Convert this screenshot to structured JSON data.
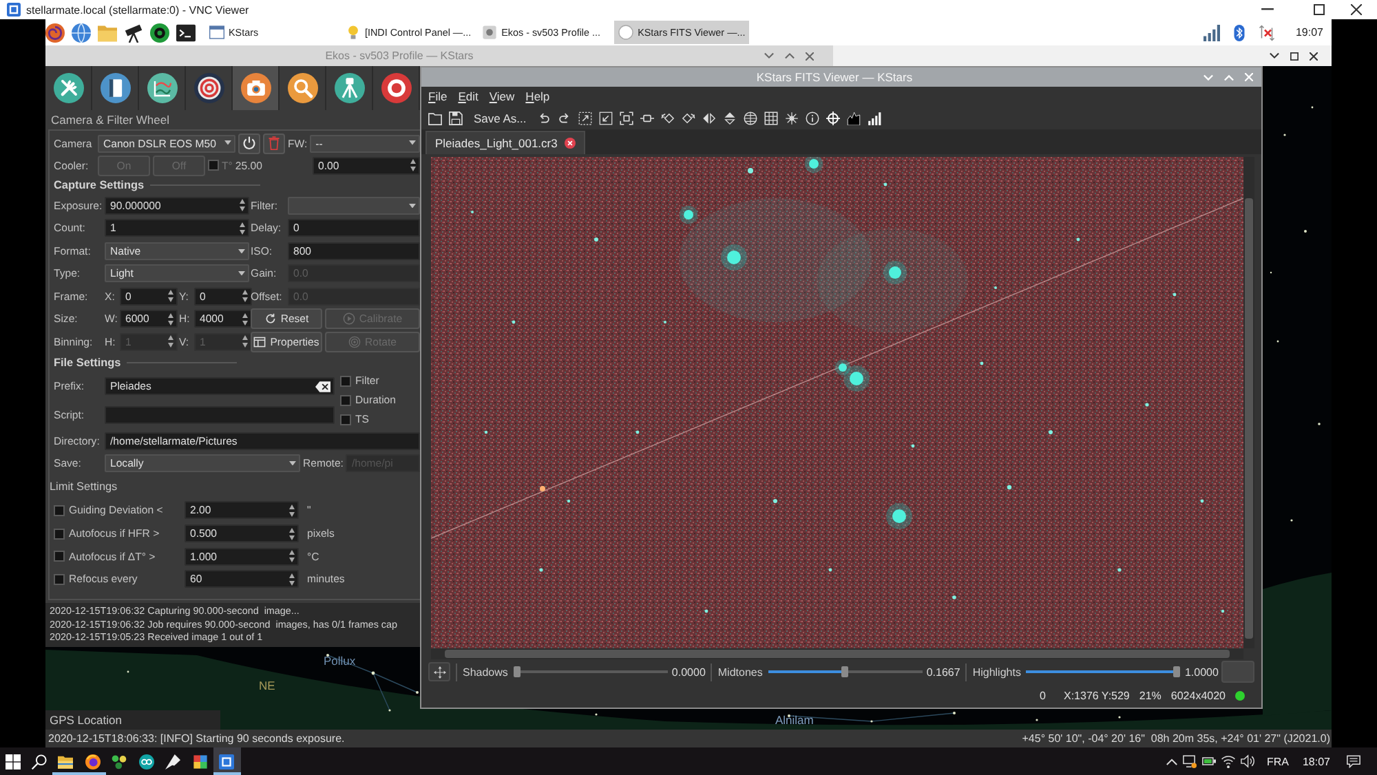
{
  "vnc_window": {
    "title": "stellarmate.local (stellarmate:0) - VNC Viewer"
  },
  "pi_taskbar": {
    "tasks": [
      {
        "label": "KStars",
        "selected": false
      },
      {
        "label": "[INDI Control Panel —...",
        "selected": false
      },
      {
        "label": "Ekos - sv503 Profile ...",
        "selected": false
      },
      {
        "label": "KStars FITS Viewer —...",
        "selected": true
      }
    ],
    "clock": "19:07"
  },
  "ekos_window": {
    "title": "Ekos - sv503 Profile — KStars"
  },
  "ekos": {
    "module_tabs": [
      {
        "selected": false
      },
      {
        "selected": false
      },
      {
        "selected": false
      },
      {
        "selected": false
      },
      {
        "selected": true
      },
      {
        "selected": false
      },
      {
        "selected": false
      },
      {
        "selected": false
      }
    ],
    "module_title": "Camera & Filter Wheel",
    "camera": {
      "label": "Camera",
      "device": "Canon DSLR EOS M50",
      "fw_label": "FW:",
      "fw_device": "--"
    },
    "cooler": {
      "label": "Cooler:",
      "buttons": [
        {
          "label": "On",
          "disabled": true
        },
        {
          "label": "Off",
          "disabled": true
        }
      ],
      "checked": false,
      "temperature_label": "T°",
      "temperature": "25.00",
      "setpoint": "0.00"
    },
    "capture_settings": {
      "heading": "Capture Settings",
      "rows": [
        {
          "label": "Exposure:",
          "left": {
            "kind": "spin",
            "value": "90.000000",
            "disabled": false
          },
          "right": {
            "kind": "combo",
            "label": "Filter:",
            "disabled": false
          }
        },
        {
          "label": "Count:",
          "left": {
            "kind": "spin",
            "value": "1",
            "disabled": false
          },
          "right": {
            "kind": "field",
            "label": "Delay:",
            "value": "0",
            "disabled": false
          }
        },
        {
          "label": "Format:",
          "left": {
            "kind": "combo",
            "value": "Native",
            "disabled": false
          },
          "right": {
            "kind": "field",
            "label": "ISO:",
            "value": "800",
            "disabled": false
          }
        },
        {
          "label": "Type:",
          "left": {
            "kind": "combo",
            "value": "Light",
            "disabled": false
          },
          "right": {
            "kind": "field",
            "label": "Gain:",
            "value": "0.0",
            "disabled": true
          }
        },
        {
          "label": "Frame:",
          "left": {
            "kind": "pair",
            "items": [
              {
                "label": "X:",
                "value": "0",
                "disabled": false
              },
              {
                "label": "Y:",
                "value": "0",
                "disabled": false
              }
            ]
          },
          "right": {
            "kind": "field",
            "label": "Offset:",
            "value": "0.0",
            "disabled": true
          }
        },
        {
          "label": "Size:",
          "left": {
            "kind": "pair",
            "items": [
              {
                "label": "W:",
                "value": "6000",
                "disabled": false
              },
              {
                "label": "H:",
                "value": "4000",
                "disabled": false
              }
            ]
          },
          "right": {
            "kind": "buttons",
            "items": [
              {
                "label": "Reset",
                "disabled": false
              },
              {
                "label": "Calibrate",
                "disabled": true
              }
            ]
          }
        },
        {
          "label": "Binning:",
          "left": {
            "kind": "pair",
            "items": [
              {
                "label": "H:",
                "value": "1",
                "disabled": true
              },
              {
                "label": "V:",
                "value": "1",
                "disabled": true
              }
            ]
          },
          "right": {
            "kind": "buttons",
            "items": [
              {
                "label": "Properties",
                "disabled": false
              },
              {
                "label": "Rotate",
                "disabled": true
              }
            ]
          }
        }
      ]
    },
    "file_settings": {
      "heading": "File Settings",
      "prefix": {
        "label": "Prefix:",
        "value": "Pleiades"
      },
      "script": {
        "label": "Script:"
      },
      "options": [
        {
          "label": "Filter",
          "checked": false
        },
        {
          "label": "Duration",
          "checked": false
        },
        {
          "label": "TS",
          "checked": false
        }
      ],
      "directory": {
        "label": "Directory:",
        "value": "/home/stellarmate/Pictures"
      },
      "save": {
        "label": "Save:",
        "value": "Locally"
      },
      "remote": {
        "label": "Remote:",
        "placeholder": "/home/pi",
        "disabled": true
      }
    },
    "limit_settings": {
      "heading": "Limit Settings",
      "items": [
        {
          "label": "Guiding Deviation <",
          "value": "2.00",
          "unit": "\"",
          "checked": false
        },
        {
          "label": "Autofocus if HFR >",
          "value": "0.500",
          "unit": "pixels",
          "checked": false
        },
        {
          "label": "Autofocus if ΔT° >",
          "value": "1.000",
          "unit": "°C",
          "checked": false
        },
        {
          "label": "Refocus every",
          "value": "60",
          "unit": "minutes",
          "checked": false
        }
      ]
    },
    "log": [
      "2020-12-15T19:06:32 Capturing 90.000-second  image...",
      "2020-12-15T19:06:32 Job requires 90.000-second  images, has 0/1 frames cap",
      "2020-12-15T19:05:23 Received image 1 out of 1"
    ]
  },
  "fits_viewer": {
    "title": "KStars FITS Viewer — KStars",
    "menu": [
      "File",
      "Edit",
      "View",
      "Help"
    ],
    "save_as": "Save As...",
    "tab": "Pleiades_Light_001.cr3",
    "stretch": [
      {
        "label": "Shadows",
        "level": 0,
        "reading": "0.0000"
      },
      {
        "label": "Midtones",
        "level": 0.5,
        "reading": "0.1667"
      },
      {
        "label": "Highlights",
        "level": 1,
        "reading": "1.0000"
      }
    ],
    "status": [
      "0",
      "X:1376 Y:529",
      "21%",
      "6024x4020"
    ]
  },
  "sky_map": {
    "labels": [
      "Pollux",
      "NE",
      "Alnilam"
    ]
  },
  "gps_location": "GPS Location",
  "status_bar": {
    "message": "2020-12-15T18:06:33: [INFO] Starting 90 seconds exposure.",
    "coordinates": "+45° 50' 10\", -04° 20' 16\"  08h 20m 35s, +24° 01' 27\" (J2021.0)"
  },
  "windows_taskbar": {
    "apps": [
      {
        "running": true,
        "selected": false
      },
      {
        "running": true,
        "selected": false
      },
      {
        "running": false,
        "selected": false
      },
      {
        "running": false,
        "selected": false
      },
      {
        "running": false,
        "selected": false
      },
      {
        "running": false,
        "selected": false
      },
      {
        "running": true,
        "selected": true
      }
    ],
    "language": "FRA",
    "clock": "18:07"
  }
}
